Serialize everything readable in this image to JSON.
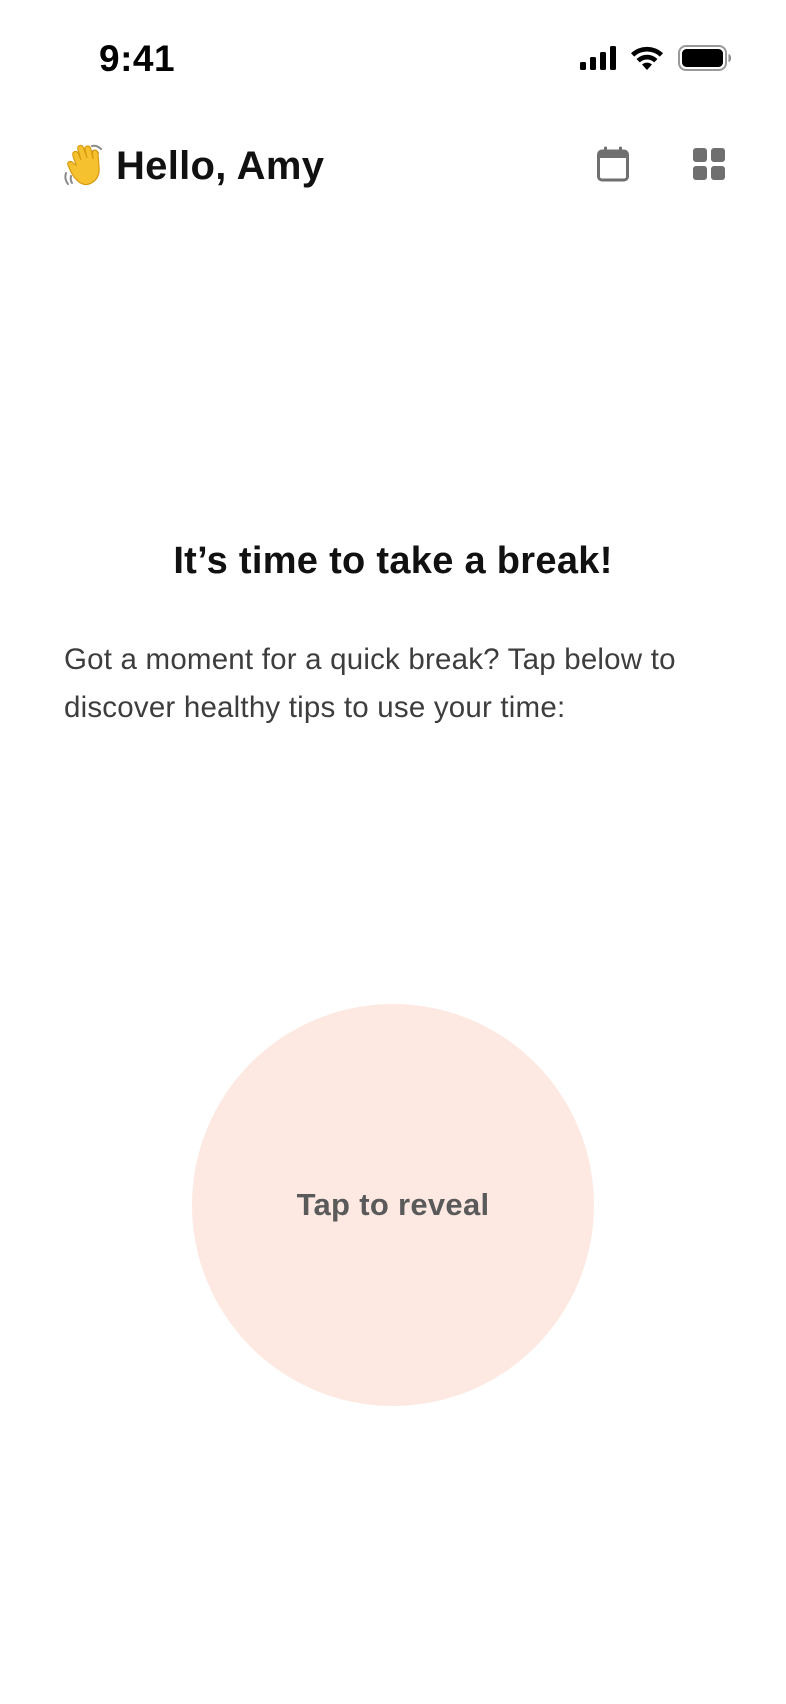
{
  "status_bar": {
    "time": "9:41",
    "icons": [
      "cellular-signal-icon",
      "wifi-icon",
      "battery-icon"
    ]
  },
  "header": {
    "emoji": "👋",
    "greeting": "Hello, Amy",
    "actions": [
      "calendar-icon",
      "apps-grid-icon"
    ]
  },
  "main": {
    "title": "It’s time to take a break!",
    "description": "Got a moment for a quick break? Tap below to discover healthy tips to use your time:"
  },
  "reveal": {
    "label": "Tap to reveal",
    "color": "#fde9e1"
  }
}
